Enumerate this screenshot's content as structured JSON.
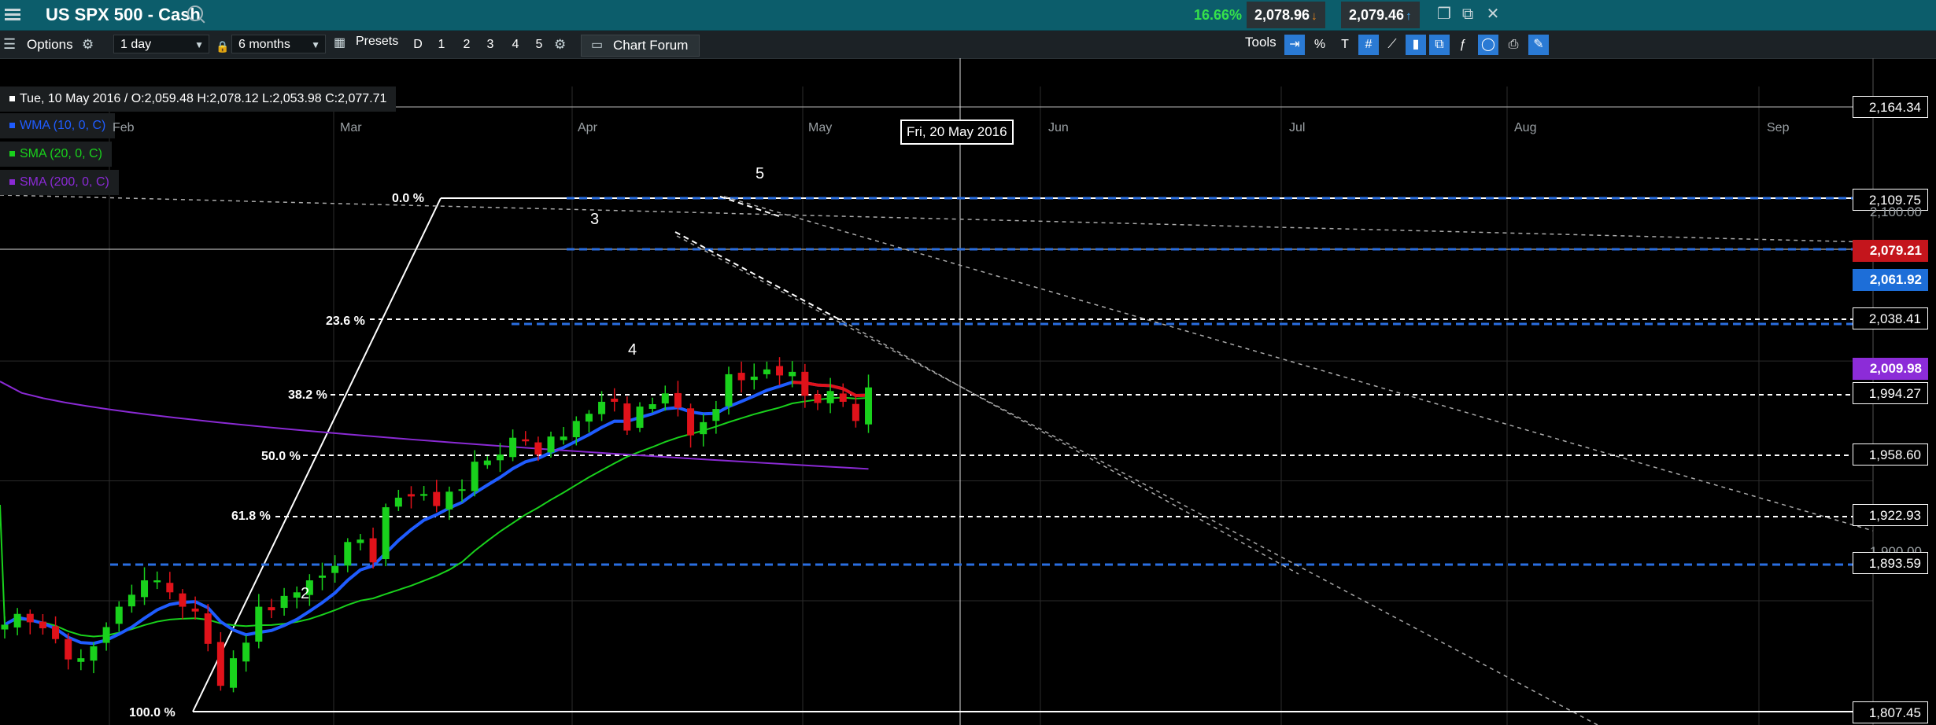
{
  "titlebar": {
    "title": "US SPX 500 - Cash",
    "change_pct": "16.66%",
    "sell_price": "2,078.96",
    "buy_price": "2,079.46",
    "sell_arrow": "↓",
    "buy_arrow": "↑",
    "colors": {
      "bg": "#0c5d6b",
      "change": "#35e14b",
      "down": "#f08a1c",
      "up": "#3fb0ff"
    }
  },
  "toolbar": {
    "options_label": "Options",
    "interval": "1 day",
    "range": "6 months",
    "presets_label": "Presets",
    "preset_buttons": [
      "D",
      "1",
      "2",
      "3",
      "4",
      "5"
    ],
    "chart_forum_label": "Chart Forum",
    "tools_label": "Tools",
    "percent_label": "%",
    "text_tool_label": "T"
  },
  "info": {
    "ohlc": "Tue, 10 May 2016 / O:2,059.48  H:2,078.12  L:2,053.98  C:2,077.71",
    "wma": "WMA (10, 0, C)",
    "sma20": "SMA (20, 0, C)",
    "sma200": "SMA (200, 0, C)",
    "colors": {
      "wma": "#1f5cff",
      "sma20": "#19d11c",
      "sma200": "#8a2ad4"
    }
  },
  "x_axis": {
    "months": [
      "Feb",
      "Mar",
      "Apr",
      "May",
      "Jun",
      "Jul",
      "Aug",
      "Sep"
    ],
    "cursor_date": "Fri, 20 May 2016"
  },
  "price_axis": {
    "top_box": "2,164.34",
    "fib_0": "2,109.75",
    "grey_2100": "2,100.00",
    "last_red": "2,079.21",
    "wma_blue": "2,061.92",
    "fib_236": "2,038.41",
    "sma200_purple": "2,009.98",
    "fib_382": "1,994.27",
    "fib_50": "1,958.60",
    "fib_618": "1,922.93",
    "grey_1900": "1,900.00",
    "blue_1893": "1,893.59",
    "fib_100": "1,807.45"
  },
  "fib_labels": [
    "0.0 %",
    "23.6 %",
    "38.2 %",
    "50.0 %",
    "61.8 %",
    "100.0 %"
  ],
  "waves": [
    "2",
    "3",
    "4",
    "5"
  ],
  "chart_data": {
    "type": "candlestick",
    "xlabel": "",
    "ylabel": "",
    "ylim": [
      1795,
      2175
    ],
    "grid": true,
    "last_index": 68,
    "x_labels": [
      "Feb",
      "Mar",
      "Apr",
      "May",
      "Jun",
      "Jul",
      "Aug",
      "Sep"
    ],
    "y_ticks": [
      2164.34,
      2109.75,
      2100.0,
      2079.21,
      2061.92,
      2038.41,
      2009.98,
      1994.27,
      1958.6,
      1922.93,
      1900.0,
      1893.59,
      1807.45
    ],
    "closes": [
      1880,
      1889,
      1882,
      1877,
      1868,
      1851,
      1852,
      1862,
      1878,
      1895,
      1905,
      1917,
      1917,
      1907,
      1895,
      1891,
      1864,
      1829,
      1852,
      1865,
      1895,
      1892,
      1904,
      1907,
      1917,
      1921,
      1929,
      1949,
      1951,
      1932,
      1978,
      1986,
      1987,
      1989,
      1979,
      1991,
      1993,
      2016,
      2017,
      2022,
      2036,
      2033,
      2022,
      2037,
      2037,
      2050,
      2056,
      2066,
      2066,
      2042,
      2062,
      2064,
      2073,
      2061,
      2038,
      2049,
      2060,
      2089,
      2084,
      2087,
      2093,
      2088,
      2091,
      2071,
      2065,
      2075,
      2066,
      2050,
      2078
    ]
  }
}
